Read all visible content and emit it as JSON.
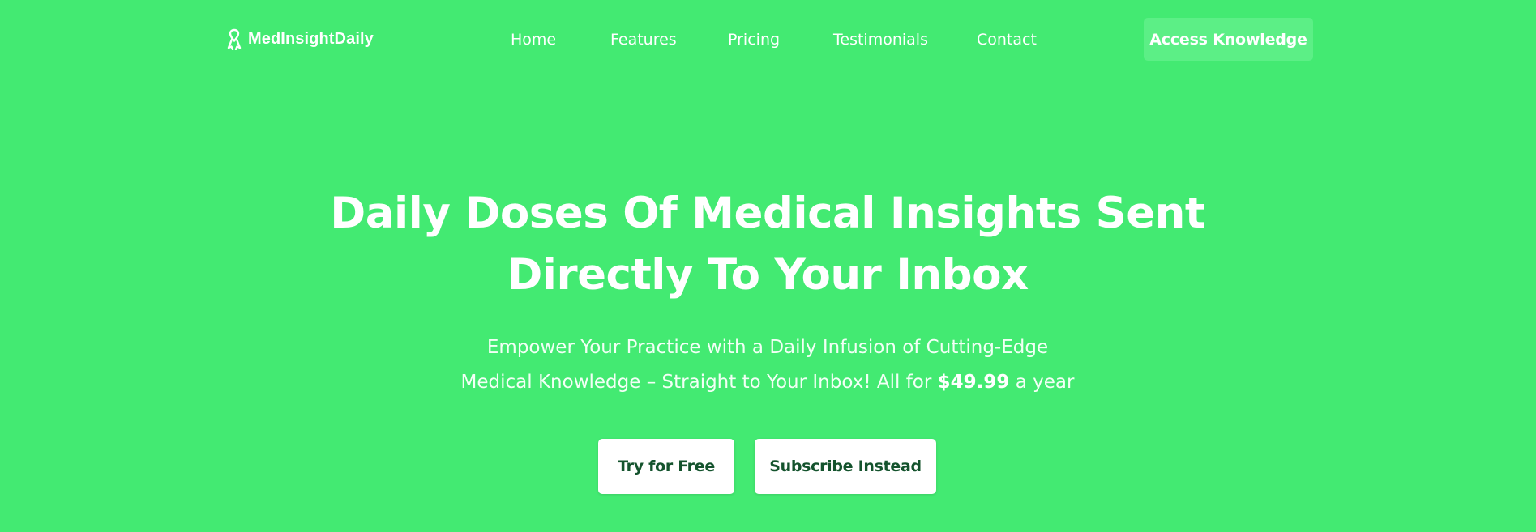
{
  "brand": {
    "name": "MedInsightDaily",
    "icon": "ribbon-icon"
  },
  "nav": {
    "items": [
      {
        "label": "Home"
      },
      {
        "label": "Features"
      },
      {
        "label": "Pricing"
      },
      {
        "label": "Testimonials"
      },
      {
        "label": "Contact"
      }
    ],
    "cta_label": "Access Knowledge"
  },
  "hero": {
    "title_line1": "Daily Doses Of Medical Insights Sent",
    "title_line2": "Directly To Your Inbox",
    "subtitle_line1": "Empower Your Practice with a Daily Infusion of Cutting-Edge",
    "subtitle_line2_prefix": "Medical Knowledge – Straight to Your Inbox! All for",
    "price": "$49.99",
    "subtitle_line2_suffix": "a year",
    "primary_button": "Try for Free",
    "secondary_button": "Subscribe Instead"
  },
  "colors": {
    "background": "#43ea72",
    "nav_cta_background": "#5cef86",
    "button_text": "#14532d",
    "text": "#ffffff"
  }
}
